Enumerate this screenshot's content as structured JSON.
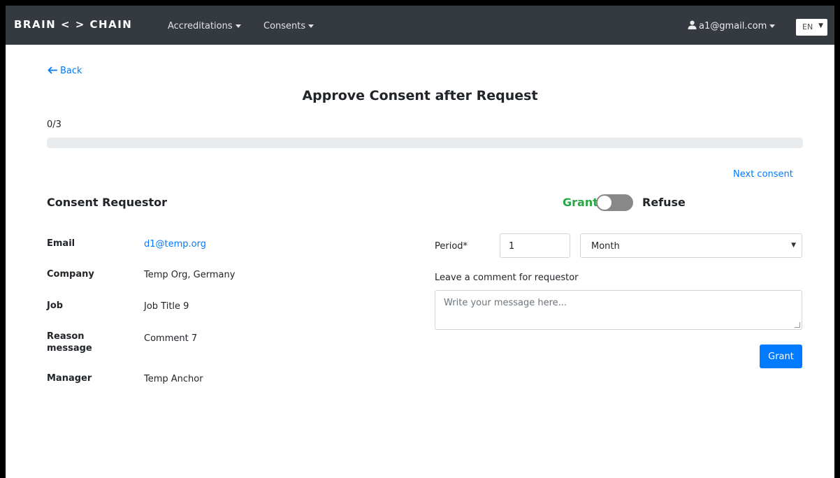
{
  "navbar": {
    "brand": "BRAIN < > CHAIN",
    "menu": [
      {
        "label": "Accreditations"
      },
      {
        "label": "Consents"
      }
    ],
    "user": "a1@gmail.com",
    "language": "EN"
  },
  "back_label": "Back",
  "page_title": "Approve Consent after Request",
  "progress": {
    "label": "0/3",
    "value": 0
  },
  "next_consent": "Next consent",
  "requestor": {
    "title": "Consent Requestor",
    "fields": [
      {
        "label": "Email",
        "value": "d1@temp.org"
      },
      {
        "label": "Company",
        "value": "Temp Org, Germany"
      },
      {
        "label": "Job",
        "value": "Job Title 9"
      },
      {
        "label": "Reason message",
        "value": "Comment 7"
      },
      {
        "label": "Manager",
        "value": "Temp Anchor"
      }
    ]
  },
  "toggle": {
    "grant_label": "Grant",
    "refuse_label": "Refuse",
    "state": "grant"
  },
  "form": {
    "period_label": "Period*",
    "period_value": "1",
    "period_unit": "Month",
    "comment_label": "Leave a comment for requestor",
    "comment_placeholder": "Write your message here...",
    "submit_label": "Grant"
  },
  "colors": {
    "primary": "#007bff",
    "grant": "#28a745",
    "navbar": "#343a40"
  }
}
